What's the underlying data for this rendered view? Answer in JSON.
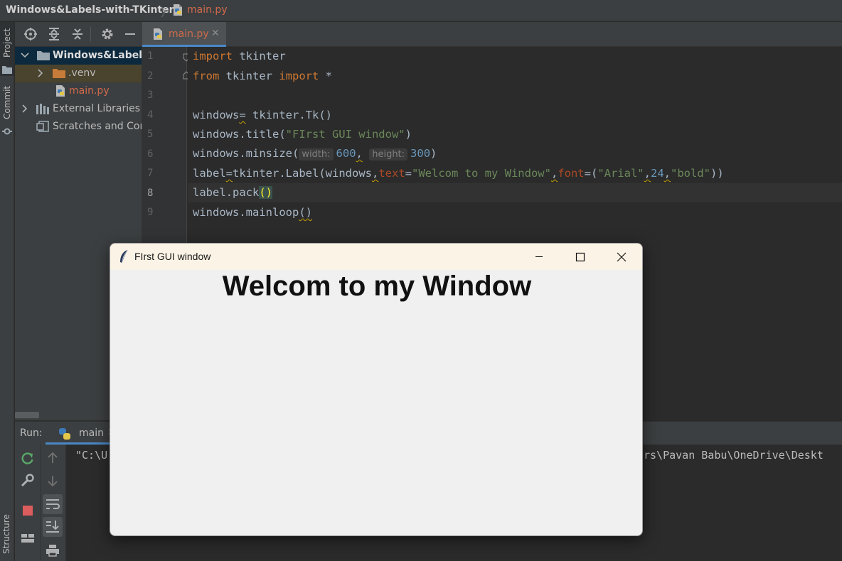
{
  "navbar": {
    "project_name": "Windows&Labels-with-TKinter",
    "separator": "〉",
    "file_name": "main.py"
  },
  "left_stripe": {
    "project_tab": "Project",
    "commit_tab": "Commit",
    "structure_tab": "Structure"
  },
  "project_panel": {
    "tree": [
      {
        "label": "Windows&Labels-",
        "type": "folder",
        "expanded": true
      },
      {
        "label": ".venv",
        "type": "folder",
        "expanded": false
      },
      {
        "label": "main.py",
        "type": "python-file"
      },
      {
        "label": "External Libraries",
        "type": "library",
        "expanded": false
      },
      {
        "label": "Scratches and Cons",
        "type": "scratches"
      }
    ]
  },
  "editor": {
    "tab_label": "main.py",
    "tab_close": "✕",
    "line_numbers": [
      "1",
      "2",
      "3",
      "4",
      "5",
      "6",
      "7",
      "8",
      "9"
    ],
    "current_line": "8",
    "code": {
      "l1_kw": "import",
      "l1_rest": " tkinter",
      "l2_kw1": "from",
      "l2_mid": " tkinter ",
      "l2_kw2": "import",
      "l2_rest": " *",
      "l4_a": "windows",
      "l4_eq": "=",
      "l4_b": " tkinter.Tk()",
      "l5_a": "windows.title(",
      "l5_str": "\"FIrst GUI window\"",
      "l5_b": ")",
      "l6_a": "windows.minsize(",
      "l6_hint1": "width:",
      "l6_num1": "600",
      "l6_comma": ",",
      "l6_hint2": "height:",
      "l6_num2": "300",
      "l6_b": ")",
      "l7_a": "label",
      "l7_eq": "=",
      "l7_b": "tkinter.Label(windows",
      "l7_c1": ",",
      "l7_kw1": "text",
      "l7_eq2": "=",
      "l7_str1": "\"Welcom to my Window\"",
      "l7_c2": ",",
      "l7_kw2": "font",
      "l7_eq3": "=(",
      "l7_str2": "\"Arial\"",
      "l7_c3": ",",
      "l7_num": "24",
      "l7_c4": ",",
      "l7_str3": "\"bold\"",
      "l7_end": "))",
      "l8_a": "label.pack",
      "l8_paren": "()",
      "l9_a": "windows.mainloop",
      "l9_paren": "()"
    }
  },
  "run_panel": {
    "title": "Run:",
    "tab_label": "main",
    "tab_close": "✕",
    "console_left": "\"C:\\U",
    "console_right": "rs\\Pavan Babu\\OneDrive\\Deskt"
  },
  "tk_window": {
    "title": "FIrst GUI window",
    "label_text": "Welcom to my Window"
  },
  "colors": {
    "ide_background": "#2b2b2b",
    "keyword": "#cc7832",
    "string": "#6a8759",
    "number": "#6897bb",
    "kwarg": "#aa4926",
    "tk_titlebar": "#fbf3e5",
    "tk_body": "#f0f0f0"
  }
}
